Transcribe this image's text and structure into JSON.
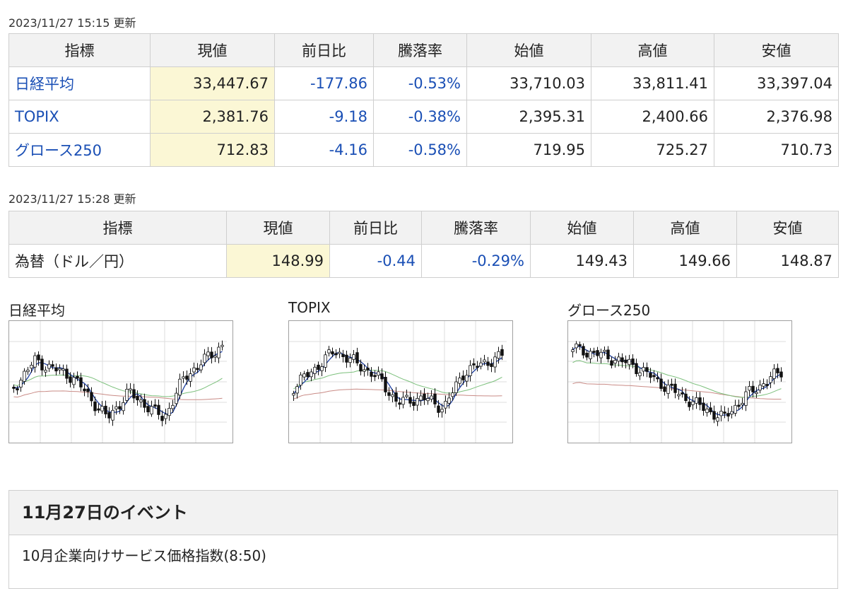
{
  "indices": {
    "updated": "2023/11/27 15:15 更新",
    "headers": [
      "指標",
      "現値",
      "前日比",
      "騰落率",
      "始値",
      "高値",
      "安値"
    ],
    "rows": [
      {
        "name": "日経平均",
        "current": "33,447.67",
        "change": "-177.86",
        "rate": "-0.53%",
        "open": "33,710.03",
        "high": "33,811.41",
        "low": "33,397.04"
      },
      {
        "name": "TOPIX",
        "current": "2,381.76",
        "change": "-9.18",
        "rate": "-0.38%",
        "open": "2,395.31",
        "high": "2,400.66",
        "low": "2,376.98"
      },
      {
        "name": "グロース250",
        "current": "712.83",
        "change": "-4.16",
        "rate": "-0.58%",
        "open": "719.95",
        "high": "725.27",
        "low": "710.73"
      }
    ]
  },
  "fx": {
    "updated": "2023/11/27 15:28 更新",
    "headers": [
      "指標",
      "現値",
      "前日比",
      "騰落率",
      "始値",
      "高値",
      "安値"
    ],
    "row": {
      "name": "為替（ドル／円）",
      "current": "148.99",
      "change": "-0.44",
      "rate": "-0.29%",
      "open": "149.43",
      "high": "149.66",
      "low": "148.87"
    }
  },
  "charts": [
    {
      "title": "日経平均"
    },
    {
      "title": "TOPIX"
    },
    {
      "title": "グロース250"
    }
  ],
  "colors": {
    "link": "#1a4fb5",
    "negative": "#1a4fb5",
    "current_bg": "#fbf7d5",
    "header_bg": "#f2f2f2",
    "ma_short": "#1f3f9f",
    "ma_mid": "#7cc07c",
    "ma_long": "#c98b86"
  },
  "events": {
    "title": "11月27日のイベント",
    "items": [
      "10月企業向けサービス価格指数(8:50)"
    ]
  }
}
